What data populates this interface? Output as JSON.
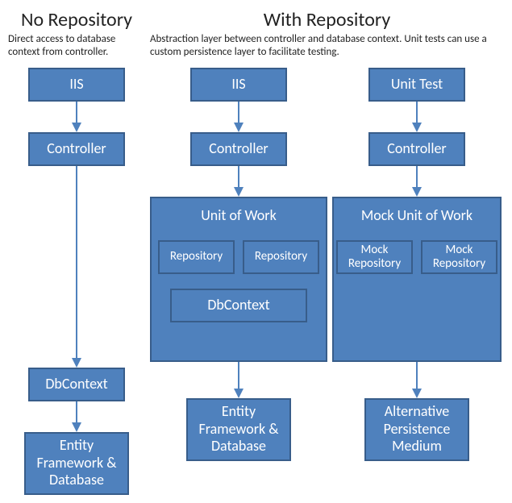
{
  "left": {
    "title": "No Repository",
    "subtitle": "Direct access to database context from controller.",
    "iis": "IIS",
    "controller": "Controller",
    "dbcontext": "DbContext",
    "efdb": "Entity Framework & Database"
  },
  "right": {
    "title": "With Repository",
    "subtitle": "Abstraction layer between controller and database context. Unit tests can use a custom persistence layer to facilitate testing.",
    "col1": {
      "iis": "IIS",
      "controller": "Controller",
      "uow": "Unit of Work",
      "repo1": "Repository",
      "repo2": "Repository",
      "dbcontext": "DbContext",
      "efdb": "Entity Framework & Database"
    },
    "col2": {
      "unit_test": "Unit Test",
      "controller": "Controller",
      "mock_uow": "Mock Unit of Work",
      "mock_repo1": "Mock Repository",
      "mock_repo2": "Mock Repository",
      "apm": "Alternative Persistence Medium"
    }
  },
  "colors": {
    "box_fill": "#4f81bd",
    "box_border": "#385d8a",
    "arrow": "#4f81bd"
  },
  "chart_data": {
    "type": "diagram",
    "sections": [
      {
        "name": "No Repository",
        "description": "Direct access to database context from controller.",
        "flows": [
          [
            "IIS",
            "Controller",
            "DbContext",
            "Entity Framework & Database"
          ]
        ]
      },
      {
        "name": "With Repository",
        "description": "Abstraction layer between controller and database context. Unit tests can use a custom persistence layer to facilitate testing.",
        "flows": [
          [
            "IIS",
            "Controller",
            "Unit of Work",
            "Entity Framework & Database"
          ],
          [
            "Unit Test",
            "Controller",
            "Mock Unit of Work",
            "Alternative Persistence Medium"
          ]
        ],
        "containers": [
          {
            "name": "Unit of Work",
            "contains": [
              "Repository",
              "Repository",
              "DbContext"
            ]
          },
          {
            "name": "Mock Unit of Work",
            "contains": [
              "Mock Repository",
              "Mock Repository"
            ]
          }
        ]
      }
    ]
  }
}
